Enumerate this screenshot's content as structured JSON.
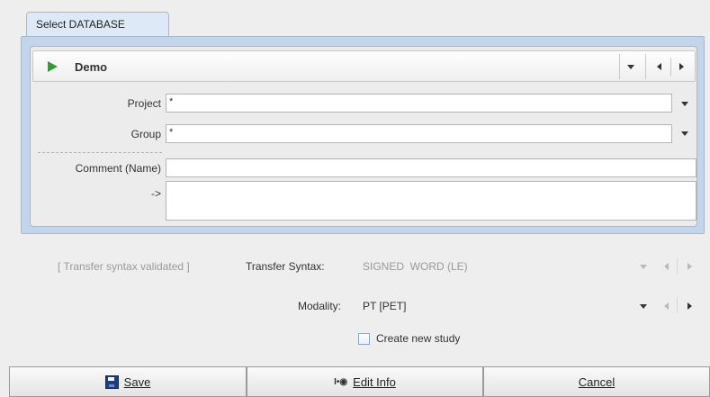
{
  "tab": {
    "label": "Select DATABASE"
  },
  "database": {
    "name": "Demo",
    "play_icon": "play-icon",
    "dropdown_icon": "triangle-down-icon",
    "prev_icon": "triangle-left-icon",
    "next_icon": "triangle-right-icon"
  },
  "form": {
    "project_label": "Project",
    "project_value": "*",
    "group_label": "Group",
    "group_value": "*",
    "comment_label": "Comment (Name)",
    "comment_value": "",
    "arrow_label": "->",
    "arrow_value": ""
  },
  "transfer": {
    "status": "[ Transfer syntax validated ]",
    "label": "Transfer Syntax:",
    "value": "SIGNED  WORD (LE)"
  },
  "modality": {
    "label": "Modality:",
    "value": "PT [PET]"
  },
  "create_study": {
    "label": "Create new study",
    "checked": false
  },
  "buttons": {
    "save": "Save",
    "edit_info": "Edit Info",
    "edit_info_icon_text": "I•◉",
    "cancel": "Cancel"
  },
  "colors": {
    "panel_border": "#c2d5ea",
    "play_green": "#2f9e2f",
    "save_blue": "#1a3d8c"
  }
}
